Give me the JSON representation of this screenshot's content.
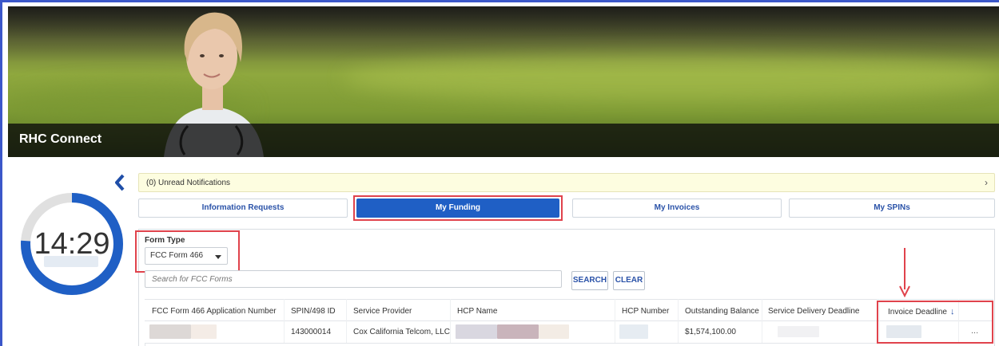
{
  "app": {
    "title": "RHC Connect"
  },
  "timer": {
    "value": "14:29",
    "progress_fraction": 0.76
  },
  "notifications": {
    "text": "(0) Unread Notifications"
  },
  "tabs": [
    {
      "label": "Information Requests",
      "active": false
    },
    {
      "label": "My Funding",
      "active": true
    },
    {
      "label": "My Invoices",
      "active": false
    },
    {
      "label": "My SPINs",
      "active": false
    }
  ],
  "filter": {
    "form_type_label": "Form Type",
    "form_type_value": "FCC Form 466",
    "search_placeholder": "Search for FCC Forms",
    "search_label": "SEARCH",
    "clear_label": "CLEAR"
  },
  "table": {
    "columns": [
      "FCC Form 466 Application Number",
      "SPIN/498 ID",
      "Service Provider",
      "HCP Name",
      "HCP Number",
      "Outstanding Balance",
      "Service Delivery Deadline",
      "Invoice Deadline"
    ],
    "rows": [
      {
        "spin": "143000014",
        "service_provider": "Cox California Telcom, LLC",
        "outstanding_balance": "$1,574,100.00",
        "action": "..."
      }
    ]
  },
  "colors": {
    "accent": "#1f5fc5",
    "highlight": "#e0434c",
    "link": "#2a52a8",
    "notice_bg": "#fdfde0"
  }
}
